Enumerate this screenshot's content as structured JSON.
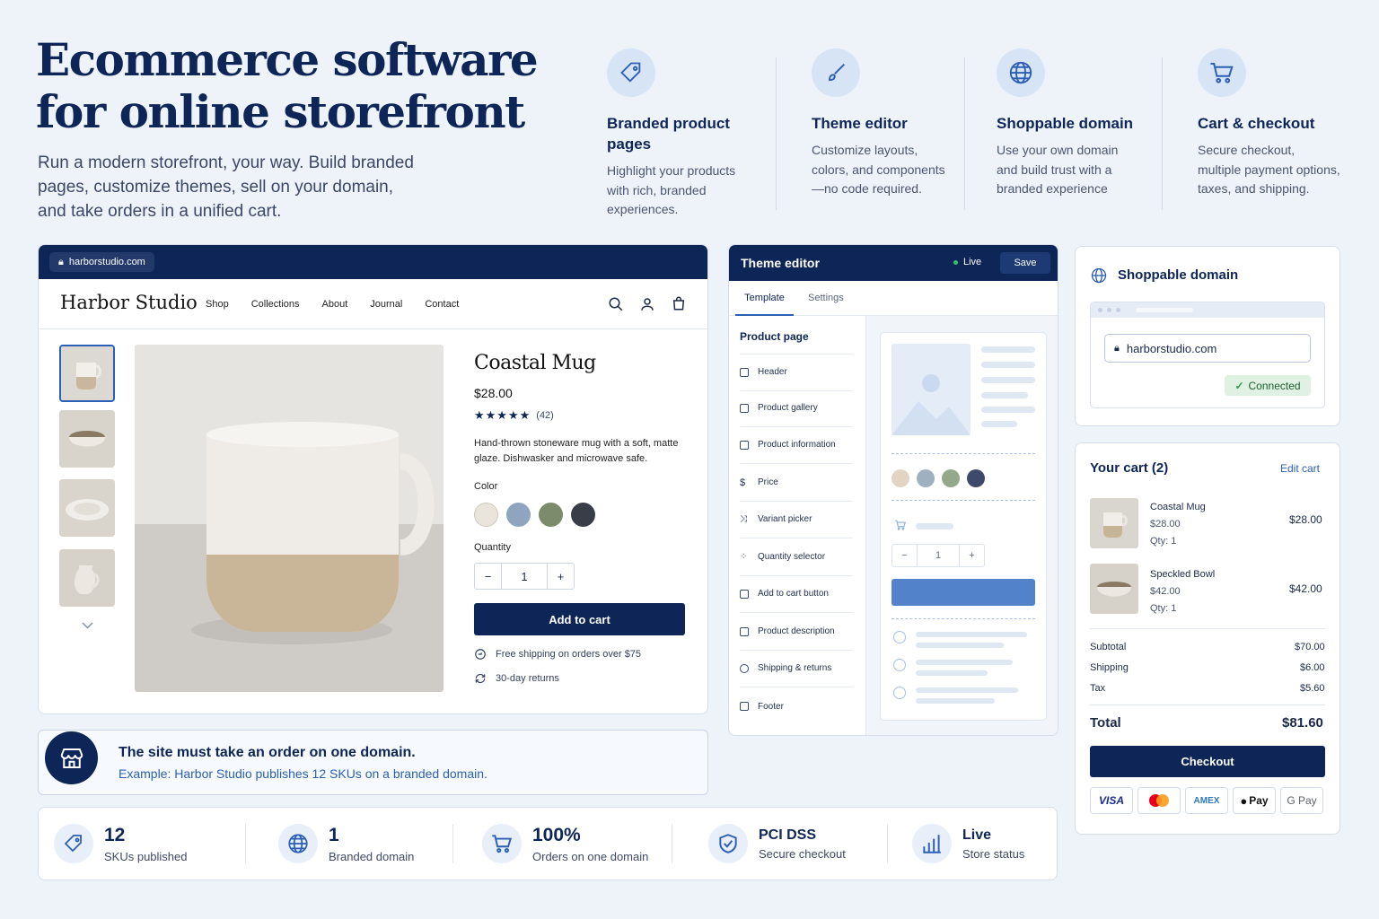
{
  "hero": {
    "title": "Ecommerce software for online storefront",
    "subtitle": "Run a modern storefront, your way. Build branded pages, customize themes, sell on your domain, and take orders in a unified cart."
  },
  "features": [
    {
      "icon": "tag-icon",
      "title": "Branded product pages",
      "desc": "Highlight your products with rich, branded experiences."
    },
    {
      "icon": "paintbrush-icon",
      "title": "Theme editor",
      "desc": "Customize layouts, colors, and components—no code required."
    },
    {
      "icon": "globe-icon",
      "title": "Shoppable domain",
      "desc": "Use your own domain and build trust with a branded experience"
    },
    {
      "icon": "cart-icon",
      "title": "Cart & checkout",
      "desc": "Secure checkout, multiple payment options, taxes, and shipping."
    }
  ],
  "store": {
    "url": "harborstudio.com",
    "brand": "Harbor Studio",
    "nav": [
      "Shop",
      "Collections",
      "About",
      "Journal",
      "Contact"
    ],
    "product": {
      "name": "Coastal Mug",
      "price": "$28.00",
      "rating_count": "(42)",
      "description": "Hand-thrown stoneware mug with a soft, matte glaze. Dishwasker and microwave safe.",
      "color_label": "Color",
      "colors": [
        "#e9e4dc",
        "#8fa5bf",
        "#7c8b6c",
        "#383d47"
      ],
      "quantity_label": "Quantity",
      "quantity": "1",
      "add_to_cart": "Add to cart",
      "shipping_note": "Free shipping on orders over $75",
      "returns_note": "30-day returns"
    }
  },
  "editor": {
    "title": "Theme editor",
    "status": "Live",
    "save": "Save",
    "tabs": [
      "Template",
      "Settings"
    ],
    "section_title": "Product page",
    "items": [
      "Header",
      "Product gallery",
      "Product information",
      "Price",
      "Variant picker",
      "Quantity selector",
      "Add to cart button",
      "Product description",
      "Shipping & returns",
      "Footer"
    ],
    "preview_qty": "1",
    "preview_colors": [
      "#e2d4c3",
      "#9fb1c1",
      "#93a98a",
      "#3e4a6c"
    ]
  },
  "domain": {
    "title": "Shoppable domain",
    "url": "harborstudio.com",
    "status": "Connected"
  },
  "cart": {
    "title": "Your cart (2)",
    "edit": "Edit cart",
    "items": [
      {
        "name": "Coastal Mug",
        "unit": "$28.00",
        "qty": "Qty: 1",
        "total": "$28.00"
      },
      {
        "name": "Speckled Bowl",
        "unit": "$42.00",
        "qty": "Qty: 1",
        "total": "$42.00"
      }
    ],
    "subtotal_label": "Subtotal",
    "subtotal": "$70.00",
    "shipping_label": "Shipping",
    "shipping": "$6.00",
    "tax_label": "Tax",
    "tax": "$5.60",
    "total_label": "Total",
    "total": "$81.60",
    "checkout": "Checkout",
    "payments": [
      "VISA",
      "Mastercard",
      "AMEX",
      "Pay",
      "G Pay"
    ]
  },
  "callout": {
    "title": "The site must take an order on one domain.",
    "example": "Example: Harbor Studio publishes 12 SKUs on a branded domain."
  },
  "stats": [
    {
      "icon": "tag-icon",
      "value": "12",
      "label": "SKUs published"
    },
    {
      "icon": "globe-icon",
      "value": "1",
      "label": "Branded domain"
    },
    {
      "icon": "cart-icon",
      "value": "100%",
      "label": "Orders on one domain"
    },
    {
      "icon": "shield-icon",
      "value": "PCI DSS",
      "label": "Secure checkout"
    },
    {
      "icon": "chart-icon",
      "value": "Live",
      "label": "Store status"
    }
  ],
  "colors": {
    "navy": "#0d2557",
    "accent": "#2b5fb5",
    "success": "#2f9a4a"
  }
}
